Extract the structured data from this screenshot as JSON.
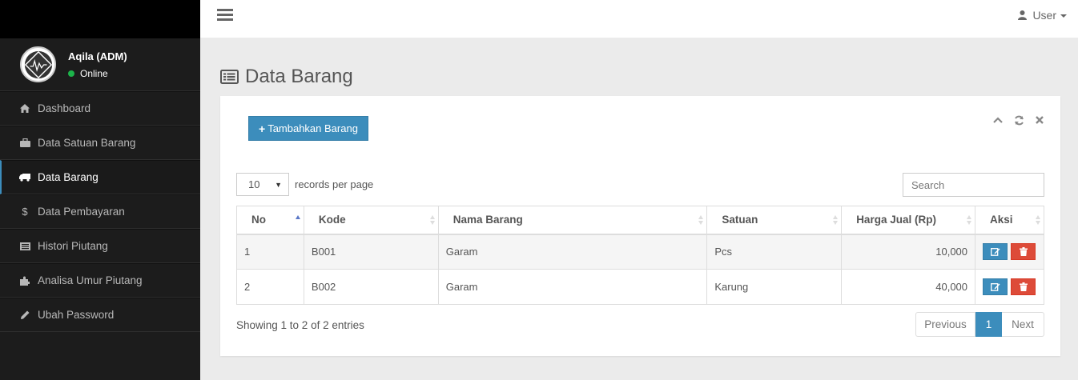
{
  "user": {
    "name": "Aqila (ADM)",
    "status": "Online"
  },
  "menu": [
    {
      "label": "Dashboard",
      "icon": "home-icon"
    },
    {
      "label": "Data Satuan Barang",
      "icon": "briefcase-icon"
    },
    {
      "label": "Data Barang",
      "icon": "truck-icon",
      "active": true
    },
    {
      "label": "Data Pembayaran",
      "icon": "dollar-icon"
    },
    {
      "label": "Histori Piutang",
      "icon": "list-alt-icon"
    },
    {
      "label": "Analisa Umur Piutang",
      "icon": "puzzle-icon"
    },
    {
      "label": "Ubah Password",
      "icon": "pencil-icon"
    }
  ],
  "topnav": {
    "user_label": "User"
  },
  "page": {
    "title": "Data Barang"
  },
  "toolbar": {
    "add_label": "Tambahkan Barang"
  },
  "table_controls": {
    "length_value": "10",
    "length_label": "records per page",
    "search_placeholder": "Search"
  },
  "table": {
    "columns": [
      "No",
      "Kode",
      "Nama Barang",
      "Satuan",
      "Harga Jual (Rp)",
      "Aksi"
    ],
    "rows": [
      {
        "no": "1",
        "kode": "B001",
        "nama": "Garam",
        "satuan": "Pcs",
        "harga": "10,000"
      },
      {
        "no": "2",
        "kode": "B002",
        "nama": "Garam",
        "satuan": "Karung",
        "harga": "40,000"
      }
    ]
  },
  "footer": {
    "info": "Showing 1 to 2 of 2 entries",
    "prev": "Previous",
    "page": "1",
    "next": "Next"
  },
  "colors": {
    "primary": "#3c8dbc",
    "danger": "#dd4b39",
    "sidebar": "#1c1c1c",
    "online": "#1cb34a"
  }
}
